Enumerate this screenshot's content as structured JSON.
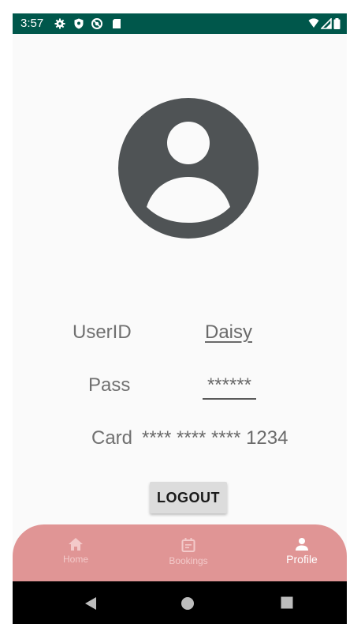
{
  "status_bar": {
    "time": "3:57",
    "color": "#00574b",
    "left_icons": [
      "gear-icon",
      "shield-icon",
      "do-not-disturb-icon",
      "sd-card-icon"
    ],
    "right_icons": [
      "wifi-icon",
      "signal-icon",
      "battery-icon"
    ]
  },
  "profile": {
    "avatar_icon": "account-circle-icon",
    "userid_label": "UserID",
    "userid_value": "Daisy",
    "pass_label": "Pass",
    "pass_value": "******",
    "card_label": "Card",
    "card_value": "**** **** **** 1234",
    "logout_label": "LOGOUT"
  },
  "bottom_nav": {
    "color": "#e09595",
    "items": [
      {
        "label": "Home",
        "icon": "home-icon",
        "active": false
      },
      {
        "label": "Bookings",
        "icon": "calendar-icon",
        "active": false
      },
      {
        "label": "Profile",
        "icon": "person-icon",
        "active": true
      }
    ]
  },
  "system_nav": {
    "buttons": [
      "back-icon",
      "home-circle-icon",
      "recents-icon"
    ]
  }
}
